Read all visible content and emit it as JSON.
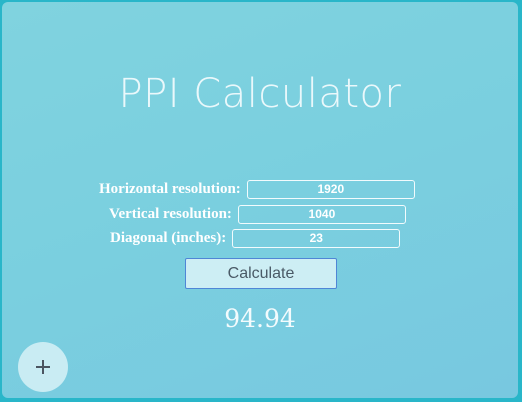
{
  "title": "PPI Calculator",
  "form": {
    "horizontal": {
      "label": "Horizontal resolution:",
      "value": "1920"
    },
    "vertical": {
      "label": "Vertical resolution:",
      "value": "1040"
    },
    "diagonal": {
      "label": "Diagonal (inches):",
      "value": "23"
    }
  },
  "calculate_label": "Calculate",
  "result": "94.94",
  "fab": {
    "icon": "plus-icon"
  },
  "colors": {
    "background": "#7acfdf",
    "frame": "#29b6c9",
    "button_border": "#4f86d6"
  }
}
